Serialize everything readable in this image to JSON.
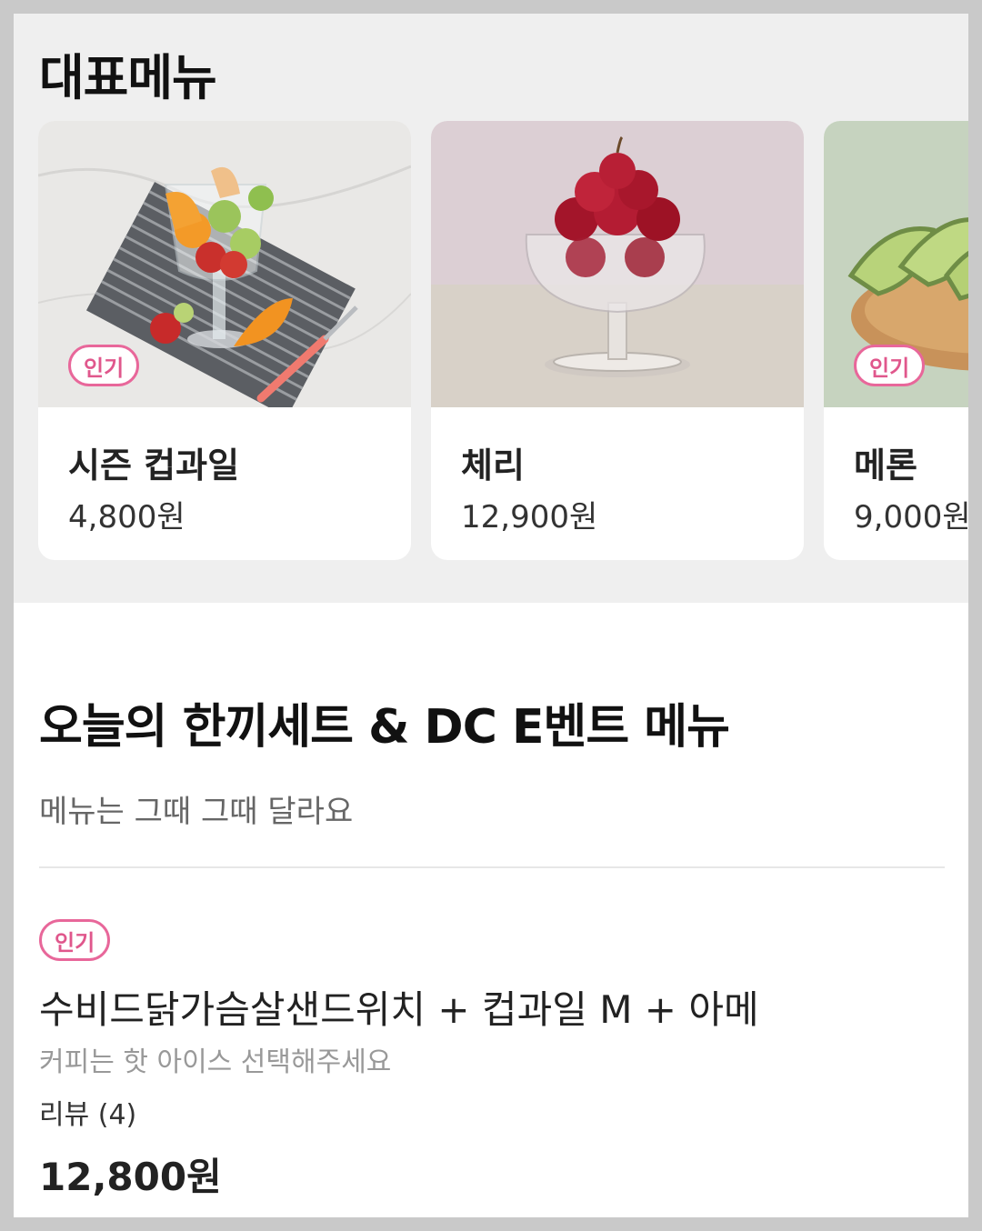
{
  "featured": {
    "title": "대표메뉴",
    "cards": [
      {
        "name": "시즌 컵과일",
        "price": "4,800원",
        "badge": "인기",
        "image": "fruit-cup-photo"
      },
      {
        "name": "체리",
        "price": "12,900원",
        "badge": "",
        "image": "cherry-bowl-photo"
      },
      {
        "name": "메론",
        "price": "9,000원",
        "badge": "인기",
        "image": "melon-plate-photo"
      }
    ]
  },
  "section": {
    "title": "오늘의 한끼세트 & DC E벤트 메뉴",
    "subtitle": "메뉴는 그때 그때 달라요"
  },
  "items": [
    {
      "badge": "인기",
      "name": "수비드닭가슴살샌드위치 + 컵과일 M + 아메",
      "description": "커피는 핫 아이스 선택해주세요",
      "review": "리뷰 (4)",
      "price": "12,800원"
    }
  ],
  "colors": {
    "badge_pink": "#e8679a",
    "featured_bg": "#efefef"
  }
}
